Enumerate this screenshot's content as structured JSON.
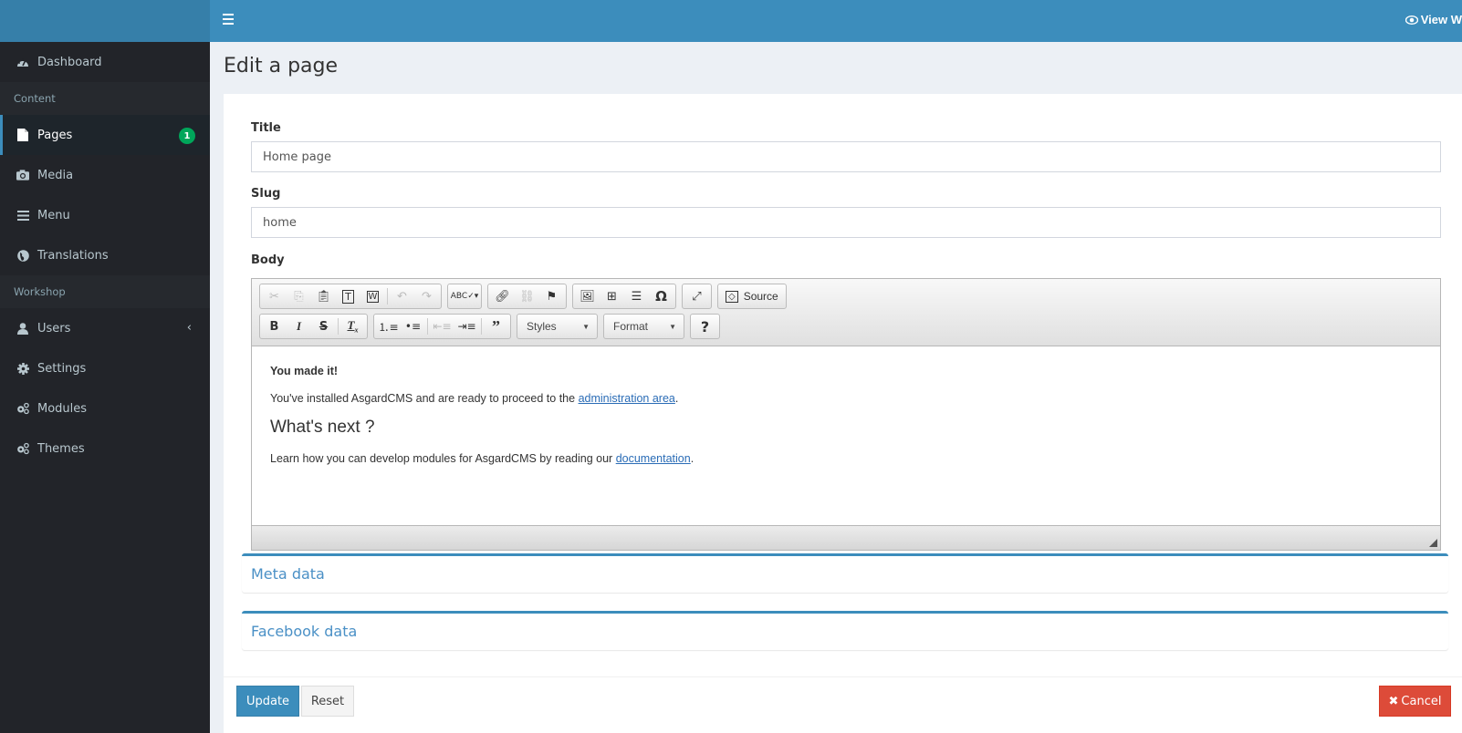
{
  "header": {
    "menu_toggle": "toggle-navigation",
    "view_site_label": "View W"
  },
  "sidebar": {
    "items": [
      {
        "label": "Dashboard",
        "icon": "dashboard-icon"
      },
      {
        "section": "Content"
      },
      {
        "label": "Pages",
        "icon": "file-icon",
        "badge": "1",
        "active": true
      },
      {
        "label": "Media",
        "icon": "camera-icon"
      },
      {
        "label": "Menu",
        "icon": "bars-icon"
      },
      {
        "label": "Translations",
        "icon": "globe-icon"
      },
      {
        "section": "Workshop"
      },
      {
        "label": "Users",
        "icon": "user-icon",
        "chevron": "‹"
      },
      {
        "label": "Settings",
        "icon": "cog-icon"
      },
      {
        "label": "Modules",
        "icon": "cogs-icon"
      },
      {
        "label": "Themes",
        "icon": "cogs-icon"
      }
    ]
  },
  "page": {
    "title": "Edit a page",
    "form": {
      "title_label": "Title",
      "title_value": "Home page",
      "slug_label": "Slug",
      "slug_value": "home",
      "body_label": "Body"
    },
    "editor": {
      "toolbar_row1": [
        "Cut",
        "Copy",
        "Paste",
        "Paste as plain text",
        "Paste from Word",
        "Undo",
        "Redo",
        "Spell Check",
        "Link",
        "Unlink",
        "Anchor",
        "Image",
        "Table",
        "Horizontal Line",
        "Special Character",
        "Maximize",
        "Source"
      ],
      "toolbar_row2": [
        "Bold",
        "Italic",
        "Strikethrough",
        "Remove Format",
        "Numbered List",
        "Bulleted List",
        "Decrease Indent",
        "Increase Indent",
        "Blockquote"
      ],
      "source_label": "Source",
      "styles_label": "Styles",
      "format_label": "Format",
      "help_label": "?",
      "content": {
        "heading1": "You made it!",
        "para1_text": "You've installed AsgardCMS and are ready to proceed to the ",
        "para1_link": "administration area",
        "para1_end": ".",
        "heading2": "What's next ?",
        "para2_text": "Learn how you can develop modules for AsgardCMS by reading our ",
        "para2_link": "documentation",
        "para2_end": "."
      }
    },
    "panels": [
      {
        "title": "Meta data"
      },
      {
        "title": "Facebook data"
      }
    ],
    "buttons": {
      "update": "Update",
      "reset": "Reset",
      "cancel": "Cancel"
    }
  },
  "colors": {
    "primary": "#3c8dbc",
    "sidebar_bg": "#222429",
    "badge_green": "#00a65a",
    "danger": "#dd4b39"
  }
}
